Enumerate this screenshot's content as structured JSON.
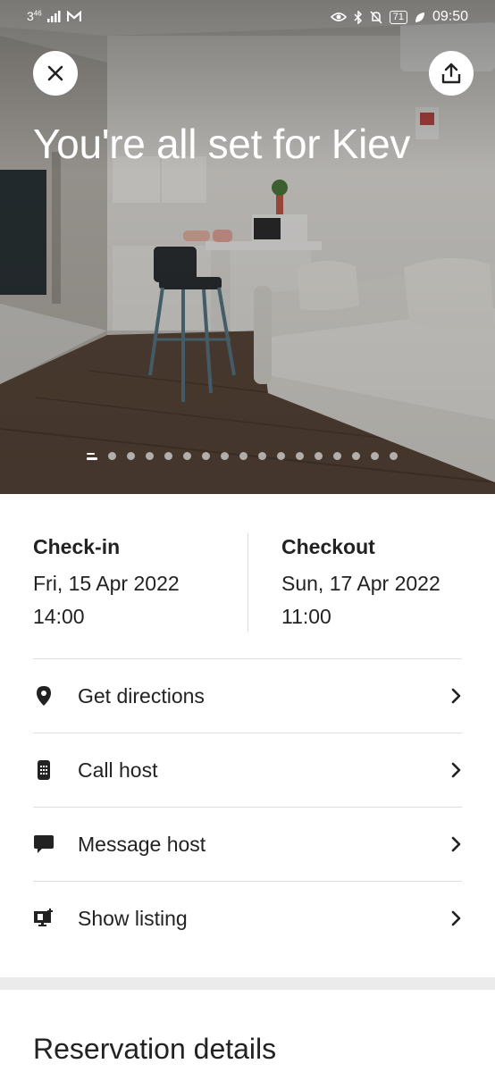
{
  "status_bar": {
    "network": "3",
    "network_sup": "46",
    "carrier_icon": "gmail-icon",
    "battery": "71",
    "time": "09:50"
  },
  "hero": {
    "title": "You're all set for Kiev",
    "photo_count": 17,
    "active_photo": 1,
    "close_icon": "close-icon",
    "share_icon": "share-icon"
  },
  "stay": {
    "checkin": {
      "label": "Check-in",
      "date": "Fri, 15 Apr 2022",
      "time": "14:00"
    },
    "checkout": {
      "label": "Checkout",
      "date": "Sun, 17 Apr 2022",
      "time": "11:00"
    }
  },
  "actions": [
    {
      "label": "Get directions",
      "icon": "location-pin-icon"
    },
    {
      "label": "Call host",
      "icon": "phone-icon"
    },
    {
      "label": "Message host",
      "icon": "message-icon"
    },
    {
      "label": "Show listing",
      "icon": "listing-icon"
    }
  ],
  "section": {
    "title": "Reservation details"
  },
  "colors": {
    "text": "#222222",
    "divider": "#dddddd",
    "band": "#ebebeb"
  }
}
